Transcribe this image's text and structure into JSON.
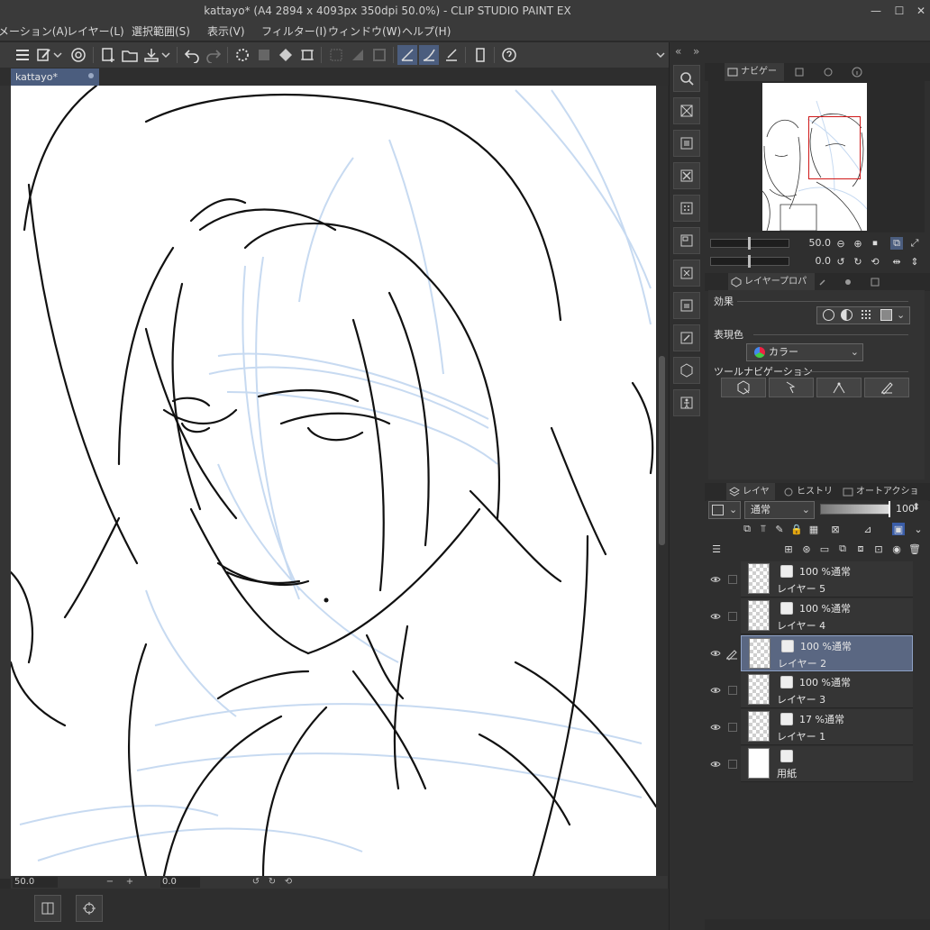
{
  "titlebar": {
    "title": "kattayo* (A4 2894 x 4093px 350dpi 50.0%)  - CLIP STUDIO PAINT EX",
    "minimize": "—",
    "maximize": "☐",
    "close": "✕"
  },
  "menu": {
    "items": [
      "メーション(A)",
      "レイヤー(L)",
      "選択範囲(S)",
      "表示(V)",
      "フィルター(I)",
      "ウィンドウ(W)",
      "ヘルプ(H)"
    ]
  },
  "document": {
    "tab_label": "kattayo*"
  },
  "canvas_status": {
    "zoom": "50.0",
    "angle": "0.0",
    "minus": "−",
    "plus": "+"
  },
  "panels": {
    "collapse_left": "«",
    "collapse_right": "»",
    "navigator_tab": "ナビゲーター",
    "zoom_value": "50.0",
    "rotate_value": "0.0",
    "property_tab": "レイヤープロパティ",
    "effect_label": "効果",
    "expression_label": "表現色",
    "expression_value": "カラー",
    "tool_nav_label": "ツールナビゲーション",
    "layer_tab": "レイヤー",
    "history_tab": "ヒストリー",
    "auto_action_tab": "オートアクション",
    "blend_mode": "通常",
    "layer_opacity": "100"
  },
  "layers": [
    {
      "opacity": "100 %通常",
      "name": "レイヤー 5",
      "selected": false,
      "thumb": "check"
    },
    {
      "opacity": "100 %通常",
      "name": "レイヤー 4",
      "selected": false,
      "thumb": "check"
    },
    {
      "opacity": "100 %通常",
      "name": "レイヤー 2",
      "selected": true,
      "thumb": "check"
    },
    {
      "opacity": "100 %通常",
      "name": "レイヤー 3",
      "selected": false,
      "thumb": "check"
    },
    {
      "opacity": "17 %通常",
      "name": "レイヤー 1",
      "selected": false,
      "thumb": "check"
    },
    {
      "opacity": "",
      "name": "用紙",
      "selected": false,
      "thumb": "white"
    }
  ],
  "colors": {
    "accent": "#4b5d7e",
    "selected_layer": "#5a6782",
    "sketch_blue": "#c7daf1",
    "nav_frame": "#d01818"
  }
}
